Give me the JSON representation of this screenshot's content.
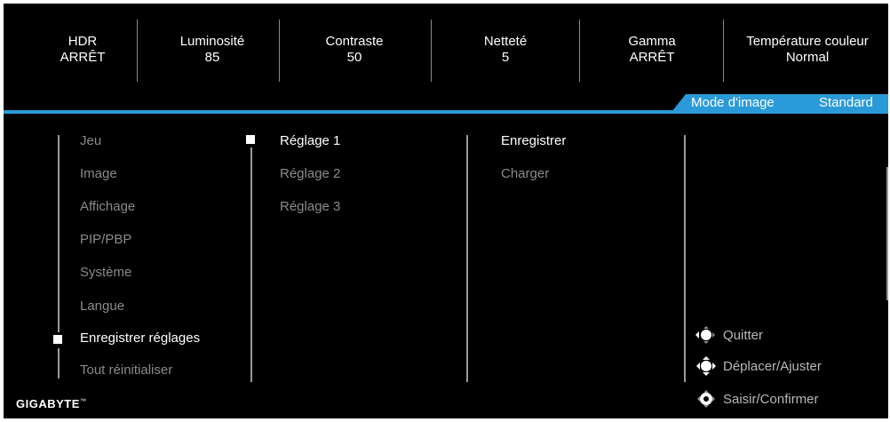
{
  "top_bar": [
    {
      "label": "HDR",
      "value": "ARRÊT"
    },
    {
      "label": "Luminosité",
      "value": "85"
    },
    {
      "label": "Contraste",
      "value": "50"
    },
    {
      "label": "Netteté",
      "value": "5"
    },
    {
      "label": "Gamma",
      "value": "ARRÊT"
    },
    {
      "label": "Température couleur",
      "value": "Normal"
    }
  ],
  "picture_mode": {
    "label": "Mode d'image",
    "value": "Standard"
  },
  "main_menu": [
    "Jeu",
    "Image",
    "Affichage",
    "PIP/PBP",
    "Système",
    "Langue",
    "Enregistrer réglages",
    "Tout réinitialiser"
  ],
  "main_menu_selected": "Enregistrer réglages",
  "sub_menu": [
    "Réglage 1",
    "Réglage 2",
    "Réglage 3"
  ],
  "sub_menu_selected": "Réglage 1",
  "actions": [
    "Enregistrer",
    "Charger"
  ],
  "actions_selected": "Enregistrer",
  "hints": [
    {
      "icon": "joystick-left-icon",
      "label": "Quitter"
    },
    {
      "icon": "joystick-move-icon",
      "label": "Déplacer/Ajuster"
    },
    {
      "icon": "joystick-press-icon",
      "label": "Saisir/Confirmer"
    }
  ],
  "brand": {
    "name": "GIGABYTE",
    "mark": "™"
  },
  "colors": {
    "accent": "#2a9ad8",
    "background": "#000000",
    "active_text": "#ffffff",
    "inactive_text": "#8b8b8b"
  }
}
